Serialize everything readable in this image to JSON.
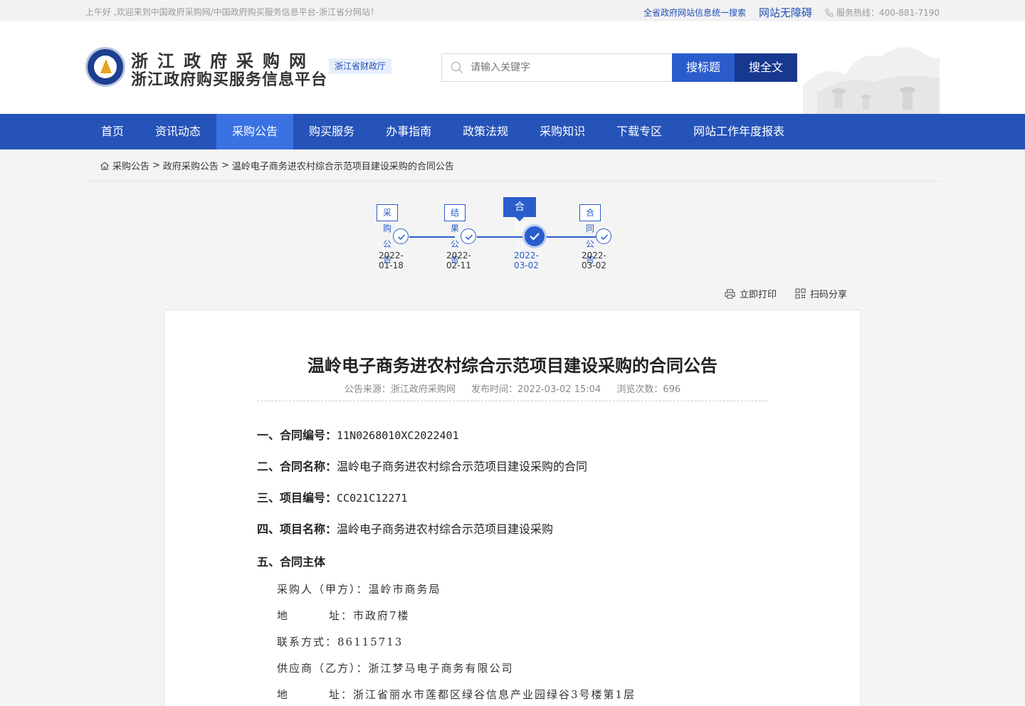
{
  "topbar": {
    "greeting": "上午好 ,欢迎来到中国政府采购网/中国政府购买服务信息平台-浙江省分网站！",
    "unified_search": "全省政府网站信息统一搜索",
    "accessibility": "网站无障碍",
    "hotline": "服务热线：400-881-7190"
  },
  "header": {
    "title_line1": "浙江政府采购网",
    "title_line2": "浙江政府购买服务信息平台",
    "dept_badge": "浙江省财政厅",
    "search_placeholder": "请输入关键字",
    "search_title_btn": "搜标题",
    "search_full_btn": "搜全文"
  },
  "nav": {
    "items": [
      "首页",
      "资讯动态",
      "采购公告",
      "购买服务",
      "办事指南",
      "政策法规",
      "采购知识",
      "下载专区",
      "网站工作年度报表"
    ],
    "active_index": 2
  },
  "breadcrumb": {
    "l1": "采购公告",
    "l2": "政府采购公告",
    "l3": "温岭电子商务进农村综合示范项目建设采购的合同公告",
    "sep": ">"
  },
  "timeline": [
    {
      "label": "采购公告",
      "date": "2022-01-18",
      "active": false
    },
    {
      "label": "结果公告",
      "date": "2022-02-11",
      "active": false
    },
    {
      "label": "合同公告",
      "date": "2022-03-02",
      "active": true
    },
    {
      "label": "合同公告",
      "date": "2022-03-02",
      "active": false
    }
  ],
  "tools": {
    "print": "立即打印",
    "share": "扫码分享"
  },
  "article": {
    "title": "温岭电子商务进农村综合示范项目建设采购的合同公告",
    "source": "公告来源：浙江政府采购网",
    "publish_time": "发布时间：2022-03-02 15:04",
    "views": "浏览次数：696",
    "s1_label": "一、合同编号：",
    "s1_value": "11N0268010XC2022401",
    "s2_label": "二、合同名称：",
    "s2_value": "温岭电子商务进农村综合示范项目建设采购的合同",
    "s3_label": "三、项目编号：",
    "s3_value": "CC021C12271",
    "s4_label": "四、项目名称：",
    "s4_value": "温岭电子商务进农村综合示范项目建设采购",
    "s5_label": "五、合同主体",
    "buyer": "采购人（甲方）：温岭市商务局",
    "buyer_addr_label": "地",
    "buyer_addr": "址：市政府7楼",
    "buyer_contact": "联系方式：86115713",
    "supplier": "供应商（乙方）：浙江梦马电子商务有限公司",
    "supplier_addr_label": "地",
    "supplier_addr": "址：浙江省丽水市莲都区绿谷信息产业园绿谷3号楼第1层"
  }
}
